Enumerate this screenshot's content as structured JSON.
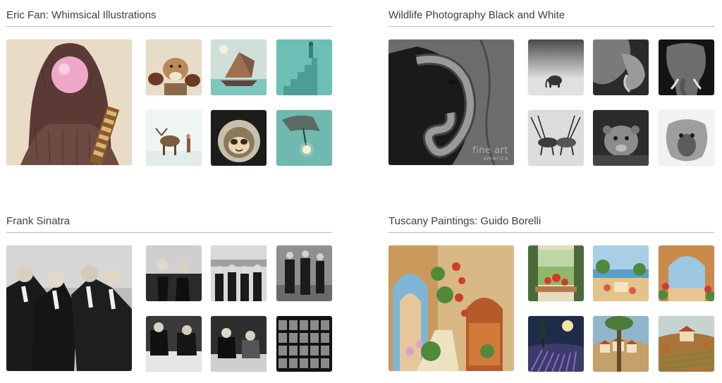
{
  "collections": [
    {
      "id": "eric-fan",
      "title": "Eric Fan: Whimsical Illustrations",
      "images": [
        {
          "subject": "bigfoot-bubblegum"
        },
        {
          "subject": "boxing-dog"
        },
        {
          "subject": "butterfly-ship"
        },
        {
          "subject": "teal-staircase"
        },
        {
          "subject": "moose-in-snow"
        },
        {
          "subject": "astronaut-sloth"
        },
        {
          "subject": "bird-lantern"
        }
      ]
    },
    {
      "id": "wildlife-bw",
      "title": "Wildlife Photography Black and White",
      "images": [
        {
          "subject": "elephant-calf",
          "watermark": "fine art",
          "watermark_sub": "america"
        },
        {
          "subject": "elephant-in-fog"
        },
        {
          "subject": "two-elephants"
        },
        {
          "subject": "elephant-on-black"
        },
        {
          "subject": "fighting-oryx"
        },
        {
          "subject": "lioness"
        },
        {
          "subject": "baboon"
        }
      ]
    },
    {
      "id": "frank-sinatra",
      "title": "Frank Sinatra",
      "images": [
        {
          "subject": "rat-pack-laughing"
        },
        {
          "subject": "sinatra-at-party"
        },
        {
          "subject": "rat-pack-on-stage"
        },
        {
          "subject": "street-walk"
        },
        {
          "subject": "sinatra-at-table"
        },
        {
          "subject": "sinatra-dining"
        },
        {
          "subject": "contact-sheet"
        }
      ]
    },
    {
      "id": "tuscany-borelli",
      "title": "Tuscany Paintings: Guido Borelli",
      "images": [
        {
          "subject": "flowered-alley"
        },
        {
          "subject": "window-geraniums"
        },
        {
          "subject": "terrace-seaside"
        },
        {
          "subject": "arched-terrace"
        },
        {
          "subject": "moonlit-lavender"
        },
        {
          "subject": "hill-village"
        },
        {
          "subject": "vineyard-farmhouse"
        }
      ]
    }
  ]
}
